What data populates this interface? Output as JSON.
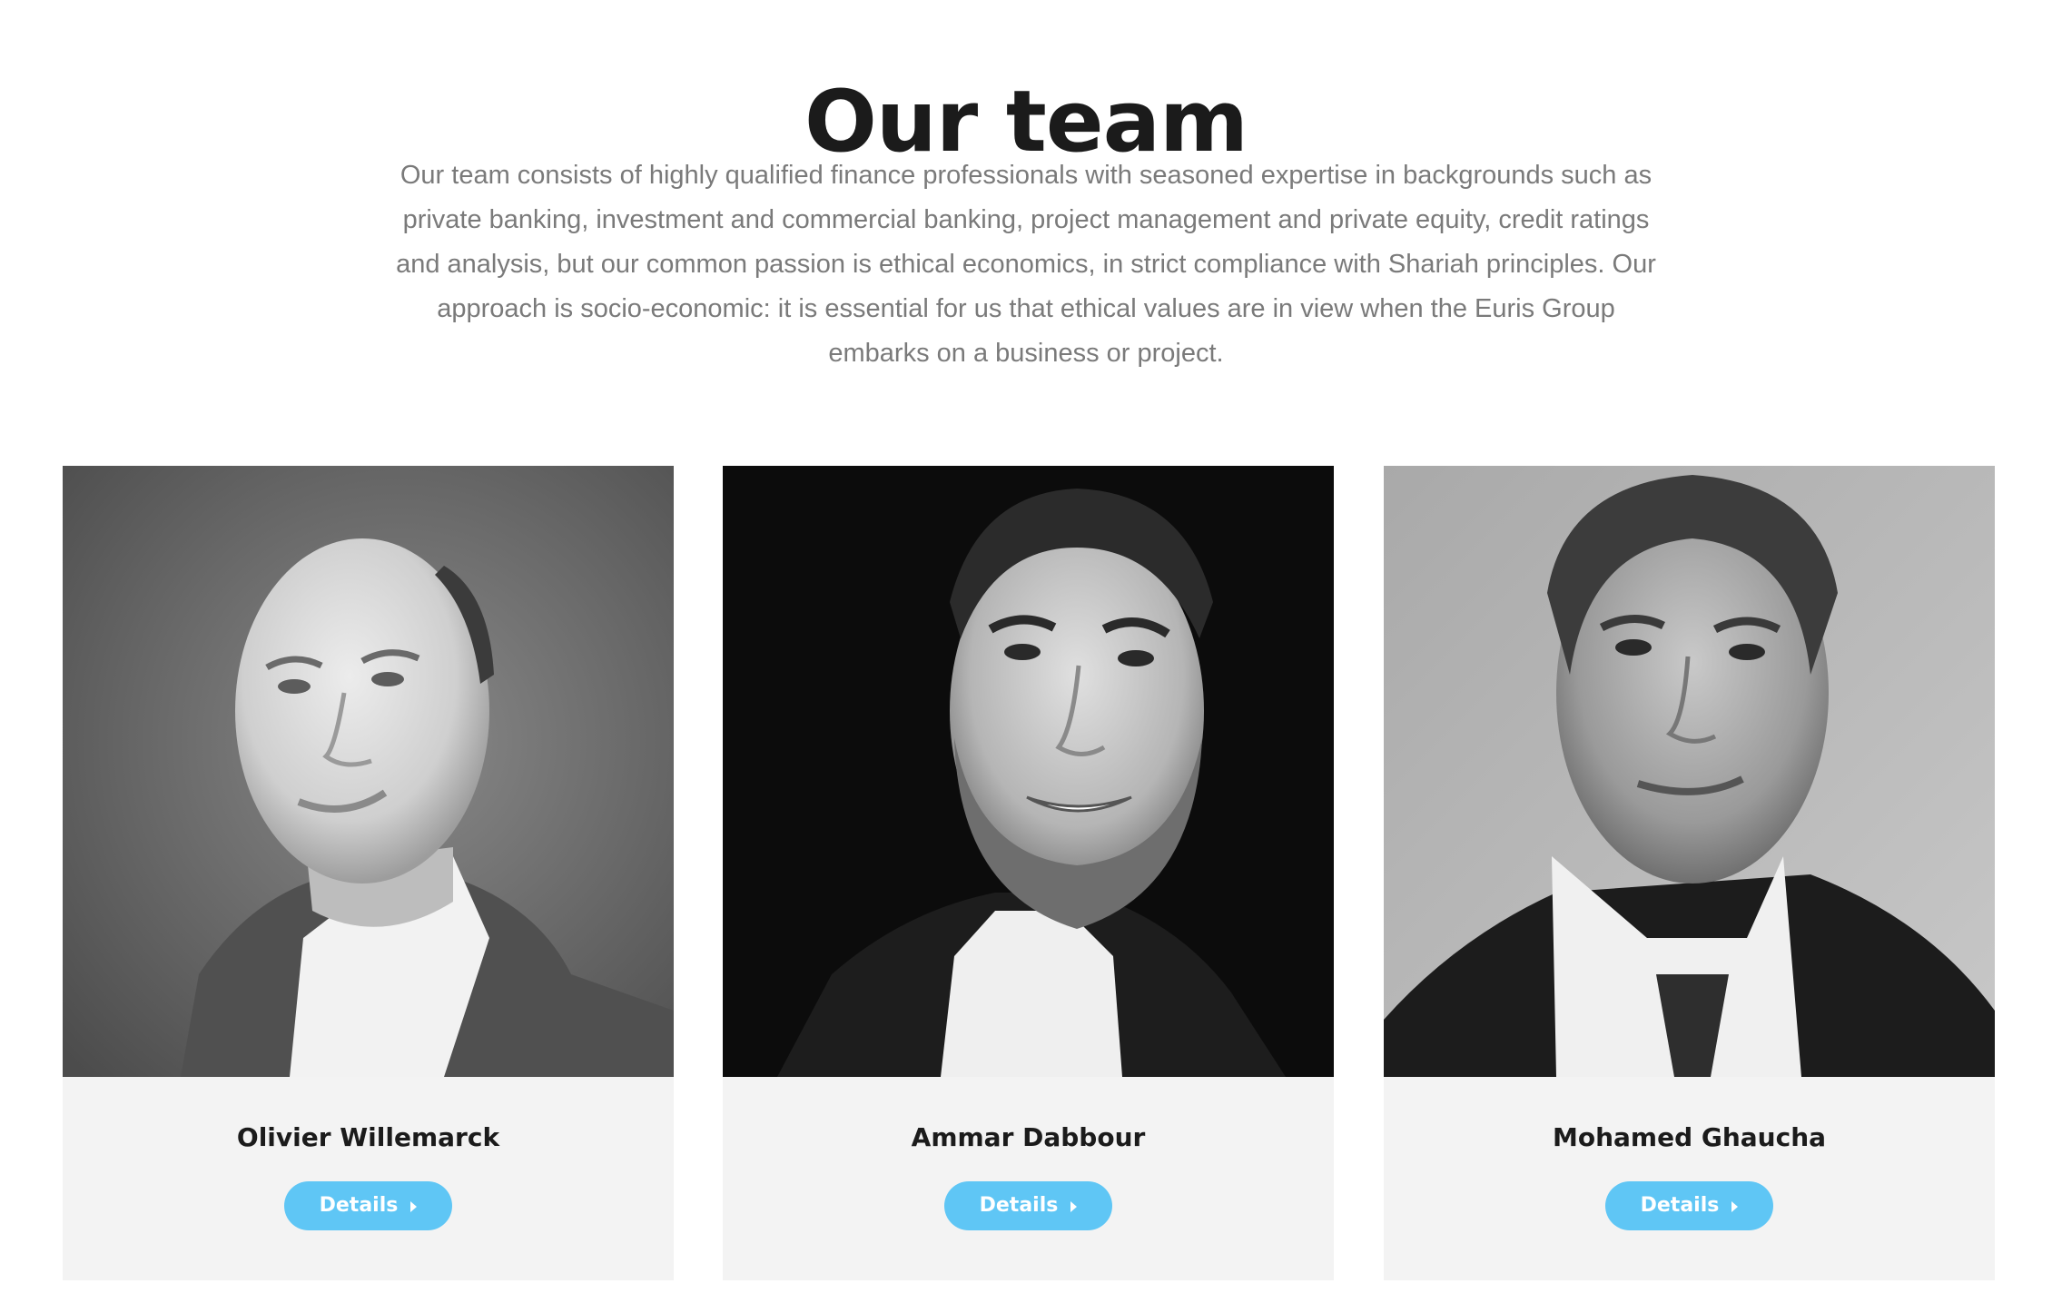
{
  "section": {
    "title": "Our team",
    "intro": "Our team consists of highly qualified finance professionals with seasoned expertise in backgrounds such as private banking, investment and commercial banking, project management and private equity, credit ratings and analysis, but our common passion is ethical economics, in strict compliance with Shariah principles. Our approach is socio-economic: it is essential for us that ethical values are in view when the Euris Group embarks on a business or project."
  },
  "team": [
    {
      "name": "Olivier Willemarck",
      "details_label": "Details",
      "icon": "caret-right-icon"
    },
    {
      "name": "Ammar Dabbour",
      "details_label": "Details",
      "icon": "caret-right-icon"
    },
    {
      "name": "Mohamed Ghaucha",
      "details_label": "Details",
      "icon": "caret-right-icon"
    }
  ],
  "colors": {
    "accent": "#5fc6f5",
    "card_background": "#f3f3f3",
    "title": "#1b1b1b",
    "body_text": "#7a7a7a"
  }
}
